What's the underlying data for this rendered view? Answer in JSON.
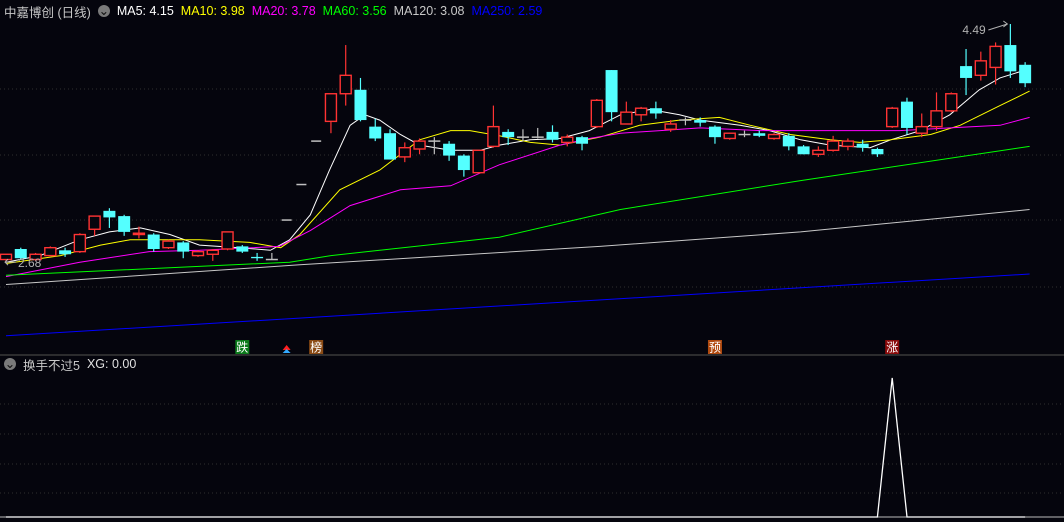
{
  "header": {
    "title": "中嘉博创 (日线)",
    "ma": [
      {
        "label": "MA5: 4.15",
        "color": "#ffffff"
      },
      {
        "label": "MA10: 3.98",
        "color": "#ffff00"
      },
      {
        "label": "MA20: 3.78",
        "color": "#ff00ff"
      },
      {
        "label": "MA60: 3.56",
        "color": "#00ff00"
      },
      {
        "label": "MA120: 3.08",
        "color": "#c8c8c8"
      },
      {
        "label": "MA250: 2.59",
        "color": "#0000ff"
      }
    ]
  },
  "sub_header": {
    "name": "换手不过5",
    "value": "XG: 0.00"
  },
  "colors": {
    "up": "#ff3333",
    "down": "#54ffff",
    "flat": "#c0c0c0",
    "background": "#05050d"
  },
  "chart_data": [
    {
      "type": "candlestick",
      "title": "中嘉博创 (日线)",
      "ylim": [
        2.0,
        4.55
      ],
      "grid": true,
      "max_label": "4.49",
      "min_label": "2.68",
      "ohlc": [
        [
          2.7,
          2.74,
          2.68,
          2.74
        ],
        [
          2.78,
          2.79,
          2.7,
          2.71
        ],
        [
          2.7,
          2.75,
          2.69,
          2.74
        ],
        [
          2.73,
          2.8,
          2.73,
          2.79
        ],
        [
          2.77,
          2.79,
          2.72,
          2.74
        ],
        [
          2.76,
          2.9,
          2.75,
          2.89
        ],
        [
          2.93,
          3.03,
          2.88,
          3.03
        ],
        [
          3.07,
          3.09,
          2.94,
          3.02
        ],
        [
          3.03,
          3.04,
          2.88,
          2.91
        ],
        [
          2.89,
          2.95,
          2.86,
          2.9
        ],
        [
          2.89,
          2.9,
          2.76,
          2.78
        ],
        [
          2.79,
          2.85,
          2.78,
          2.84
        ],
        [
          2.83,
          2.84,
          2.71,
          2.76
        ],
        [
          2.73,
          2.77,
          2.72,
          2.76
        ],
        [
          2.74,
          2.78,
          2.69,
          2.77
        ],
        [
          2.78,
          2.91,
          2.77,
          2.91
        ],
        [
          2.8,
          2.81,
          2.75,
          2.76
        ],
        [
          2.72,
          2.75,
          2.69,
          2.71
        ],
        [
          2.7,
          2.75,
          2.7,
          2.7
        ],
        [
          3.0,
          3.0,
          3.0,
          3.0
        ],
        [
          3.27,
          3.27,
          3.27,
          3.27
        ],
        [
          3.6,
          3.6,
          3.6,
          3.6
        ],
        [
          3.75,
          3.96,
          3.66,
          3.96
        ],
        [
          3.96,
          4.33,
          3.87,
          4.1
        ],
        [
          3.99,
          4.08,
          3.75,
          3.76
        ],
        [
          3.71,
          3.77,
          3.6,
          3.62
        ],
        [
          3.66,
          3.69,
          3.46,
          3.46
        ],
        [
          3.48,
          3.59,
          3.44,
          3.55
        ],
        [
          3.54,
          3.62,
          3.5,
          3.6
        ],
        [
          3.6,
          3.63,
          3.5,
          3.6
        ],
        [
          3.58,
          3.6,
          3.45,
          3.49
        ],
        [
          3.49,
          3.5,
          3.33,
          3.38
        ],
        [
          3.36,
          3.53,
          3.36,
          3.53
        ],
        [
          3.56,
          3.87,
          3.55,
          3.71
        ],
        [
          3.67,
          3.69,
          3.57,
          3.63
        ],
        [
          3.63,
          3.69,
          3.6,
          3.63
        ],
        [
          3.63,
          3.7,
          3.62,
          3.63
        ],
        [
          3.67,
          3.72,
          3.59,
          3.61
        ],
        [
          3.59,
          3.65,
          3.56,
          3.63
        ],
        [
          3.63,
          3.64,
          3.53,
          3.58
        ],
        [
          3.71,
          3.92,
          3.7,
          3.91
        ],
        [
          4.14,
          4.14,
          3.75,
          3.82
        ],
        [
          3.73,
          3.9,
          3.73,
          3.82
        ],
        [
          3.8,
          3.86,
          3.75,
          3.85
        ],
        [
          3.85,
          3.9,
          3.77,
          3.81
        ],
        [
          3.69,
          3.76,
          3.67,
          3.73
        ],
        [
          3.76,
          3.78,
          3.72,
          3.76
        ],
        [
          3.76,
          3.78,
          3.71,
          3.74
        ],
        [
          3.71,
          3.72,
          3.58,
          3.63
        ],
        [
          3.62,
          3.66,
          3.61,
          3.66
        ],
        [
          3.65,
          3.68,
          3.63,
          3.65
        ],
        [
          3.66,
          3.68,
          3.63,
          3.64
        ],
        [
          3.62,
          3.66,
          3.61,
          3.65
        ],
        [
          3.64,
          3.66,
          3.53,
          3.56
        ],
        [
          3.56,
          3.57,
          3.5,
          3.5
        ],
        [
          3.5,
          3.56,
          3.48,
          3.53
        ],
        [
          3.53,
          3.64,
          3.52,
          3.6
        ],
        [
          3.56,
          3.62,
          3.53,
          3.6
        ],
        [
          3.58,
          3.61,
          3.52,
          3.55
        ],
        [
          3.54,
          3.55,
          3.48,
          3.5
        ],
        [
          3.71,
          3.86,
          3.7,
          3.85
        ],
        [
          3.9,
          3.93,
          3.65,
          3.7
        ],
        [
          3.66,
          3.81,
          3.63,
          3.71
        ],
        [
          3.71,
          3.97,
          3.68,
          3.83
        ],
        [
          3.83,
          3.97,
          3.82,
          3.96
        ],
        [
          4.17,
          4.3,
          3.95,
          4.08
        ],
        [
          4.1,
          4.28,
          4.06,
          4.21
        ],
        [
          4.16,
          4.35,
          4.03,
          4.32
        ],
        [
          4.33,
          4.49,
          4.08,
          4.13
        ],
        [
          4.18,
          4.2,
          4.01,
          4.04
        ]
      ],
      "series": [
        {
          "name": "MA5",
          "color": "#ffffff",
          "points": [
            [
              0,
              2.68
            ],
            [
              2.3,
              2.73
            ],
            [
              5,
              2.85
            ],
            [
              7,
              2.91
            ],
            [
              9.1,
              2.94
            ],
            [
              11.1,
              2.89
            ],
            [
              13.1,
              2.81
            ],
            [
              15.8,
              2.79
            ],
            [
              17.9,
              2.77
            ],
            [
              19.2,
              2.85
            ],
            [
              20.6,
              3.04
            ],
            [
              21.9,
              3.38
            ],
            [
              23.3,
              3.72
            ],
            [
              24.3,
              3.8
            ],
            [
              25.3,
              3.76
            ],
            [
              26.7,
              3.65
            ],
            [
              28,
              3.57
            ],
            [
              30.1,
              3.53
            ],
            [
              32.1,
              3.53
            ],
            [
              33.4,
              3.57
            ],
            [
              35.5,
              3.61
            ],
            [
              37.5,
              3.62
            ],
            [
              39.5,
              3.68
            ],
            [
              41.6,
              3.8
            ],
            [
              43.6,
              3.84
            ],
            [
              45.6,
              3.8
            ],
            [
              47,
              3.76
            ],
            [
              49.7,
              3.72
            ],
            [
              51.7,
              3.68
            ],
            [
              53.8,
              3.61
            ],
            [
              55.8,
              3.57
            ],
            [
              58.5,
              3.55
            ],
            [
              59.9,
              3.61
            ],
            [
              61.9,
              3.68
            ],
            [
              63.9,
              3.8
            ],
            [
              65.9,
              3.99
            ],
            [
              67.3,
              4.08
            ],
            [
              69.3,
              4.15
            ]
          ]
        },
        {
          "name": "MA10",
          "color": "#ffff00",
          "points": [
            [
              0,
              2.67
            ],
            [
              3.7,
              2.73
            ],
            [
              6.4,
              2.81
            ],
            [
              8.4,
              2.85
            ],
            [
              13.1,
              2.85
            ],
            [
              16.5,
              2.83
            ],
            [
              18.6,
              2.79
            ],
            [
              19.9,
              2.89
            ],
            [
              22.6,
              3.23
            ],
            [
              25.3,
              3.38
            ],
            [
              28,
              3.61
            ],
            [
              30.1,
              3.68
            ],
            [
              31.4,
              3.68
            ],
            [
              33.4,
              3.64
            ],
            [
              35.5,
              3.59
            ],
            [
              37.5,
              3.57
            ],
            [
              40.2,
              3.63
            ],
            [
              42.9,
              3.72
            ],
            [
              45.6,
              3.76
            ],
            [
              48.3,
              3.78
            ],
            [
              50.4,
              3.72
            ],
            [
              53.1,
              3.65
            ],
            [
              55.8,
              3.61
            ],
            [
              57.8,
              3.59
            ],
            [
              59.9,
              3.61
            ],
            [
              62.6,
              3.65
            ],
            [
              64.6,
              3.72
            ],
            [
              67.3,
              3.87
            ],
            [
              69.3,
              3.98
            ]
          ]
        },
        {
          "name": "MA20",
          "color": "#ff00ff",
          "points": [
            [
              0,
              2.57
            ],
            [
              5,
              2.68
            ],
            [
              9.7,
              2.76
            ],
            [
              13.1,
              2.77
            ],
            [
              18.5,
              2.8
            ],
            [
              20.6,
              2.92
            ],
            [
              23.3,
              3.11
            ],
            [
              26.7,
              3.23
            ],
            [
              30.1,
              3.26
            ],
            [
              33.4,
              3.42
            ],
            [
              37.5,
              3.57
            ],
            [
              39.5,
              3.62
            ],
            [
              41.6,
              3.66
            ],
            [
              44.3,
              3.68
            ],
            [
              47,
              3.7
            ],
            [
              51.1,
              3.68
            ],
            [
              60.5,
              3.68
            ],
            [
              63.9,
              3.7
            ],
            [
              67.3,
              3.72
            ],
            [
              69.3,
              3.78
            ]
          ]
        },
        {
          "name": "MA60",
          "color": "#00ff00",
          "points": [
            [
              0,
              2.58
            ],
            [
              19.2,
              2.68
            ],
            [
              22,
              2.73
            ],
            [
              33.4,
              2.87
            ],
            [
              41.6,
              3.08
            ],
            [
              53.8,
              3.3
            ],
            [
              69.3,
              3.56
            ]
          ]
        },
        {
          "name": "MA120",
          "color": "#c8c8c8",
          "points": [
            [
              0,
              2.51
            ],
            [
              19.9,
              2.66
            ],
            [
              40.2,
              2.8
            ],
            [
              53.8,
              2.91
            ],
            [
              69.3,
              3.08
            ]
          ]
        },
        {
          "name": "MA250",
          "color": "#0000ff",
          "points": [
            [
              0,
              2.12
            ],
            [
              69.3,
              2.59
            ]
          ]
        }
      ],
      "signals": [
        {
          "index": 16,
          "label": "跌",
          "color": "#0a7a1a"
        },
        {
          "index": 21,
          "label": "榜",
          "color": "#8a4a14"
        },
        {
          "index": 48,
          "label": "预",
          "color": "#b04a10"
        },
        {
          "index": 60,
          "label": "涨",
          "color": "#8a0a0a"
        }
      ],
      "arrow_signal_index": 19
    },
    {
      "type": "line",
      "title": "换手不过5",
      "name": "XG",
      "color": "#ffffff",
      "ylim": [
        0,
        1
      ],
      "points": [
        [
          0,
          0
        ],
        [
          59,
          0
        ],
        [
          60,
          1
        ],
        [
          61,
          0
        ],
        [
          69,
          0
        ]
      ]
    }
  ]
}
